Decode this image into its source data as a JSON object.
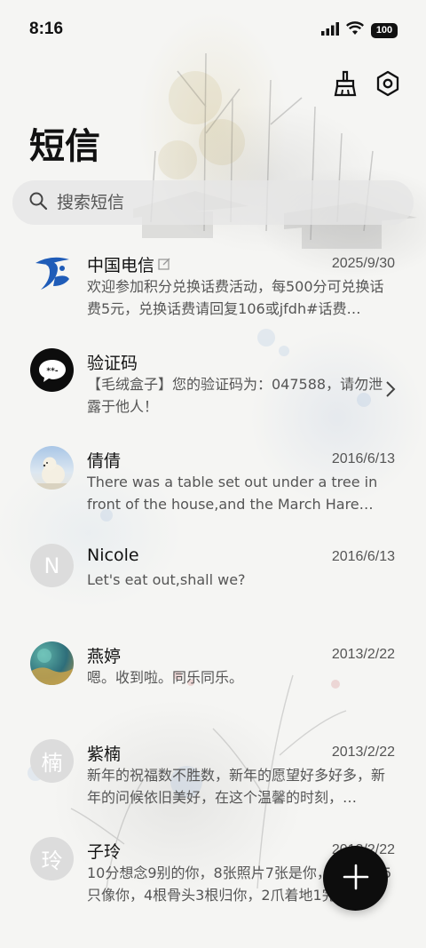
{
  "status": {
    "time": "8:16",
    "battery": "100"
  },
  "header": {
    "title": "短信",
    "icons": [
      "broom-icon",
      "settings-icon"
    ]
  },
  "search": {
    "placeholder": "搜索短信"
  },
  "conversations": [
    {
      "name": "中国电信",
      "date": "2025/9/30",
      "preview": "欢迎参加积分兑换话费活动，每500分可兑换话费5元，兑换话费请回复106或jfdh#话费…",
      "avatar": "china-telecom-logo"
    },
    {
      "name": "验证码",
      "date": "",
      "preview": "【毛绒盒子】您的验证码为：047588，请勿泄露于他人！",
      "avatar": "chat-bubble"
    },
    {
      "name": "倩倩",
      "date": "2016/6/13",
      "preview": "There was a table set out under a tree in front of the house,and the March Hare an…",
      "avatar": "polar-bear-photo"
    },
    {
      "name": "Nicole",
      "date": "2016/6/13",
      "preview": "Let's eat out,shall we?",
      "avatar_letter": "N"
    },
    {
      "name": "燕婷",
      "date": "2013/2/22",
      "preview": "嗯。收到啦。同乐同乐。",
      "avatar": "landscape-photo"
    },
    {
      "name": "紫楠",
      "date": "2013/2/22",
      "preview": "新年的祝福数不胜数，新年的愿望好多好多，新年的问候依旧美好，在这个温馨的时刻，…",
      "avatar_letter": "楠"
    },
    {
      "name": "子玲",
      "date": "2013/2/22",
      "preview": "10分想念9别的你，8张照片7张是你，6只小狗5只像你，4根骨头3根归你，2爪着地1完…",
      "avatar_letter": "玲"
    }
  ],
  "fab": {
    "icon": "plus-icon"
  }
}
